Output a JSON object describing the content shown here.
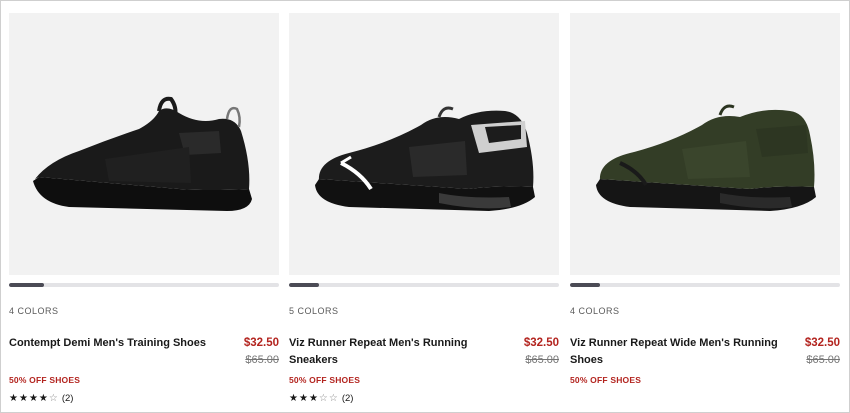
{
  "products": [
    {
      "colors_label": "4 COLORS",
      "title": "Contempt Demi Men's Training Shoes",
      "price": "$32.50",
      "original_price": "$65.00",
      "promo": "50% OFF SHOES",
      "rating": 4,
      "review_count": "(2)",
      "shoe_color": "#151515",
      "carousel_progress": 0.13
    },
    {
      "colors_label": "5 COLORS",
      "title": "Viz Runner Repeat Men's Running Sneakers",
      "price": "$32.50",
      "original_price": "$65.00",
      "promo": "50% OFF SHOES",
      "rating": 3,
      "review_count": "(2)",
      "shoe_color": "#1c1c1c",
      "carousel_progress": 0.11
    },
    {
      "colors_label": "4 COLORS",
      "title": "Viz Runner Repeat Wide Men's Running Shoes",
      "price": "$32.50",
      "original_price": "$65.00",
      "promo": "50% OFF SHOES",
      "rating": null,
      "review_count": null,
      "shoe_color": "#333d26",
      "carousel_progress": 0.11
    }
  ],
  "icons": {
    "star_filled": "★",
    "star_empty": "☆"
  },
  "colors": {
    "sale_red": "#b3241f",
    "image_bg": "#f2f2f2"
  }
}
